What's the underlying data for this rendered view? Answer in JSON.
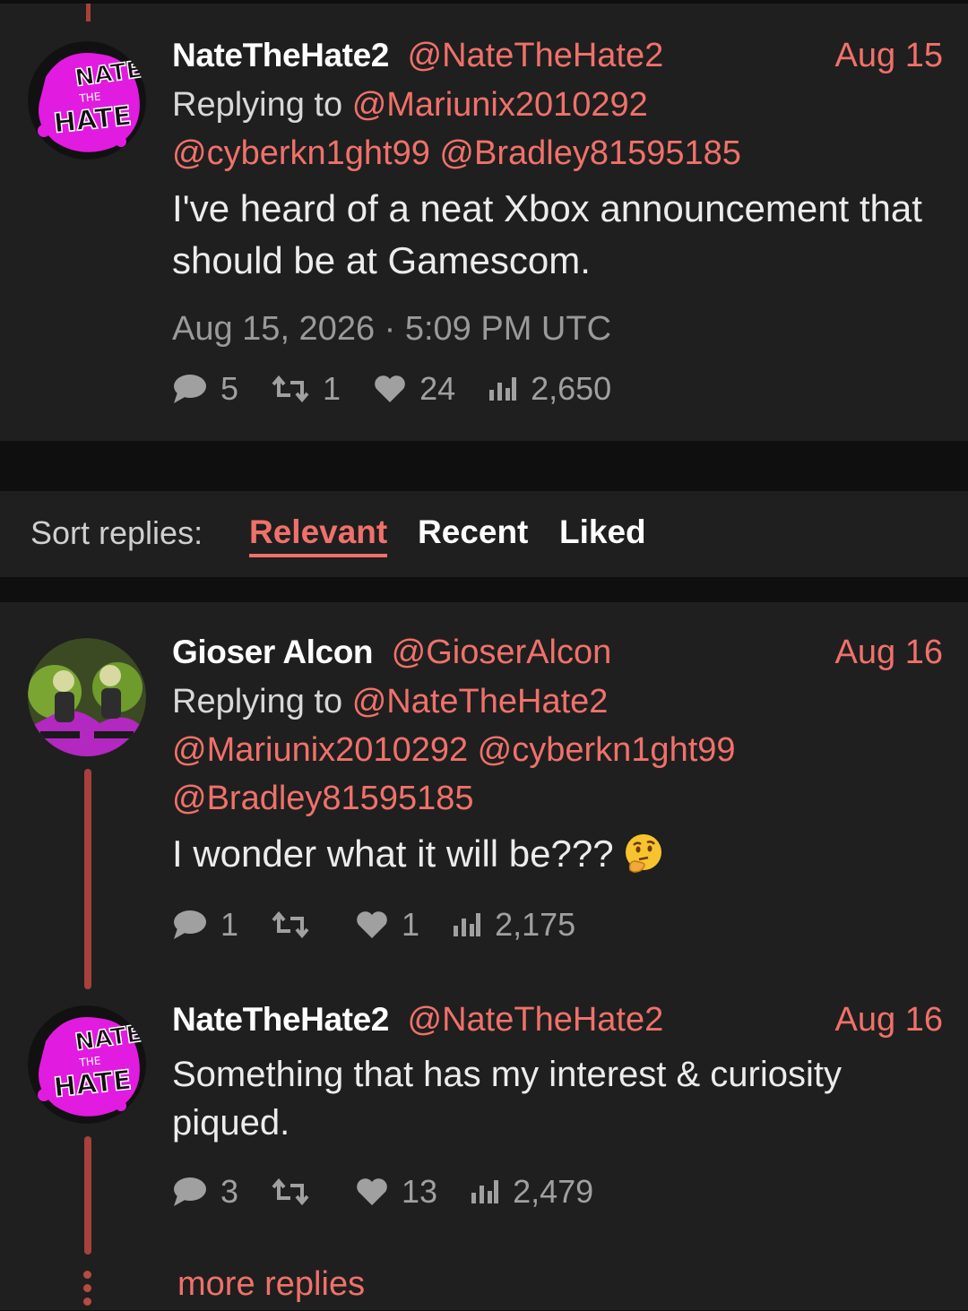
{
  "main_tweet": {
    "fullname": "NateTheHate2",
    "handle": "@NateTheHate2",
    "date": "Aug 15",
    "replying_prefix": "Replying to",
    "mentions_line1": "@Mariunix2010292",
    "mentions_line2": "@cyberkn1ght99 @Bradley81595185",
    "text": "I've heard of a neat Xbox announcement that should be at Gamescom.",
    "timestamp": "Aug 15, 2026 · 5:09 PM UTC",
    "stats": {
      "comments": "5",
      "retweets": "1",
      "likes": "24",
      "views": "2,650"
    }
  },
  "sort": {
    "label": "Sort replies:",
    "tabs": [
      "Relevant",
      "Recent",
      "Liked"
    ],
    "active": "Relevant"
  },
  "replies": [
    {
      "fullname": "Gioser Alcon",
      "handle": "@GioserAlcon",
      "date": "Aug 16",
      "replying_prefix": "Replying to",
      "mentions_line1": "@NateTheHate2",
      "mentions_line2": "@Mariunix2010292 @cyberkn1ght99",
      "mentions_line3": "@Bradley81595185",
      "text": "I wonder what it will be???",
      "emoji": "thinking-face",
      "stats": {
        "comments": "1",
        "retweets": "",
        "likes": "1",
        "views": "2,175"
      }
    },
    {
      "fullname": "NateTheHate2",
      "handle": "@NateTheHate2",
      "date": "Aug 16",
      "text": "Something that has my interest & curiosity piqued.",
      "stats": {
        "comments": "3",
        "retweets": "",
        "likes": "13",
        "views": "2,479"
      }
    }
  ],
  "more_replies": "more replies",
  "colors": {
    "accent": "#f0716a",
    "panel": "#1f1f1f",
    "background": "#0f0f0f",
    "thread_line": "#a8403b",
    "avatar_magenta": "#e21be0"
  },
  "avatar_logo": [
    "NATE",
    "THE",
    "HATE"
  ]
}
